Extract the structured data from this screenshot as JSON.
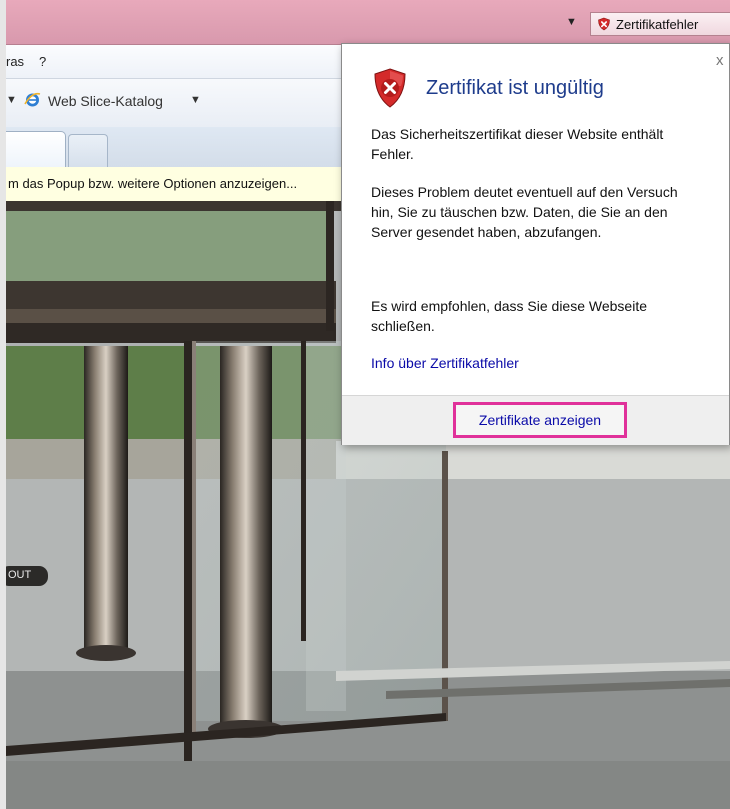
{
  "browser": {
    "cert_error_button": "Zertifikatfehler",
    "menu": {
      "extras_partial": "ras",
      "help": "?"
    },
    "favorites_bar": {
      "web_slice_label": "Web Slice-Katalog"
    },
    "infobar_text": "m das Popup bzw. weitere Optionen anzuzeigen..."
  },
  "page": {
    "exit_sign_partial": "OUT"
  },
  "certificate_popup": {
    "title": "Zertifikat ist ungültig",
    "paragraph1": "Das Sicherheitszertifikat dieser Website enthält Fehler.",
    "paragraph2": "Dieses Problem deutet eventuell auf den Versuch hin, Sie zu täuschen bzw. Daten, die Sie an den Server gesendet haben, abzufangen.",
    "paragraph3": "Es wird empfohlen, dass Sie diese Webseite schließen.",
    "info_link": "Info über Zertifikatfehler",
    "view_certificates_button": "Zertifikate anzeigen",
    "close_glyph": "x"
  },
  "colors": {
    "address_bar_error": "#e8a9bb",
    "popup_title": "#1e3c8c",
    "link": "#0a0aa8",
    "highlight_border": "#e0319a",
    "shield_red": "#d42a2a"
  },
  "icons": [
    "dropdown-arrow-icon",
    "certificate-error-shield-icon",
    "internet-explorer-icon",
    "close-icon"
  ]
}
